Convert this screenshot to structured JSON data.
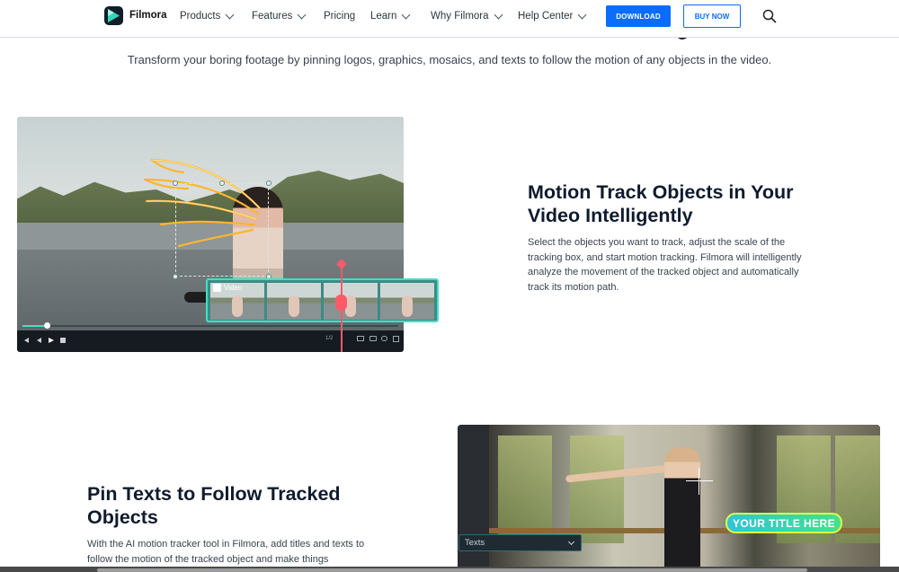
{
  "nav": {
    "brand": "Filmora",
    "items": [
      {
        "label": "Products",
        "has_dropdown": true
      },
      {
        "label": "Features",
        "has_dropdown": true
      },
      {
        "label": "Pricing",
        "has_dropdown": false
      },
      {
        "label": "Learn",
        "has_dropdown": true
      },
      {
        "label": "Why Filmora",
        "has_dropdown": true
      },
      {
        "label": "Help Center",
        "has_dropdown": true
      }
    ],
    "download_label": "DOWNLOAD",
    "buy_label": "BUY NOW",
    "search_icon": "search-icon"
  },
  "hero": {
    "subtitle": "Transform your boring footage by pinning logos, graphics, mosaics, and texts to follow the motion of any objects in the video."
  },
  "section1": {
    "heading": "Motion Track Objects in Your Video Intelligently",
    "body": "Select the objects you want to track, adjust the scale of the tracking box, and start motion tracking. Filmora will intelligently analyze the movement of the tracked object and automatically track its motion path.",
    "timeline_label": "Video",
    "player_time": "00:00:18:05",
    "player_page": "1/2"
  },
  "section2": {
    "heading": "Pin Texts to Follow Tracked Objects",
    "body": "With the AI motion tracker tool in Filmora, add titles and texts to follow the motion of the tracked object and make things",
    "title_overlay": "YOUR TITLE HERE",
    "dropdown_value": "Texts"
  },
  "colors": {
    "accent": "#0b6cff",
    "track_teal": "#42e0c3",
    "playhead": "#ff5a6a"
  }
}
